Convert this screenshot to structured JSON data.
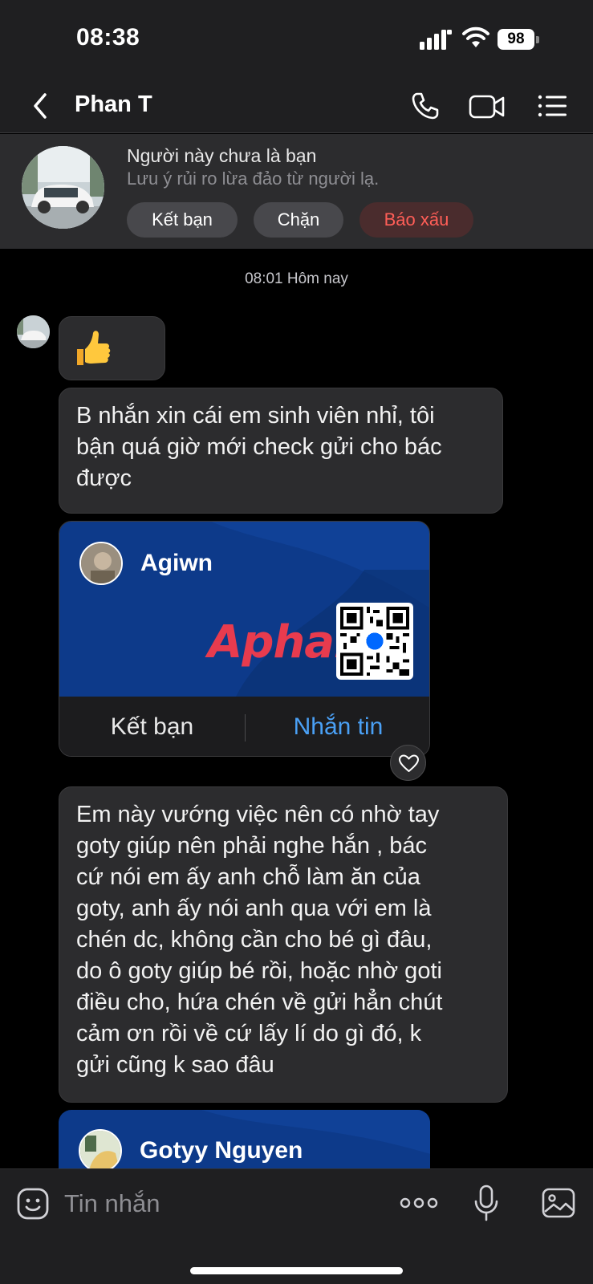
{
  "status_bar": {
    "time": "08:38",
    "battery": "98"
  },
  "header": {
    "title": "Phan T",
    "icons": [
      "back-icon",
      "phone-icon",
      "video-camera-icon",
      "list-menu-icon"
    ]
  },
  "stranger_notice": {
    "title": "Người này chưa là bạn",
    "subtitle": "Lưu ý rủi ro lừa đảo từ người lạ.",
    "add_friend_label": "Kết bạn",
    "block_label": "Chặn",
    "report_label": "Báo xấu",
    "report_color": "#ff5e57"
  },
  "chat": {
    "date_separator": "08:01 Hôm nay",
    "messages": [
      {
        "type": "sticker",
        "content": "👍"
      },
      {
        "type": "text",
        "content": "B nhắn xin cái em sinh viên nhỉ, tôi\nbận quá giờ mới check gửi cho bác\nđược"
      },
      {
        "type": "contact_card",
        "name": "Agiwn",
        "add_friend_label": "Kết bạn",
        "message_label": "Nhắn tin"
      },
      {
        "type": "text",
        "content": "Em này vướng việc nên có nhờ tay\ngoty  giúp nên phải nghe hắn , bác\ncứ nói em ấy anh chỗ làm ăn của\ngoty, anh ấy nói anh qua với em là\nchén dc, không cần cho bé gì đâu,\ndo ô goty giúp bé rồi, hoặc nhờ goti\nđiều cho, hứa chén về gửi hẳn chút\ncảm ơn rồi về cứ lấy lí do gì đó, k\ngửi cũng k sao đâu"
      },
      {
        "type": "contact_card",
        "name": "Gotyy Nguyen"
      }
    ],
    "card_watermark": "Aphang",
    "qr_badge": "Zalo"
  },
  "composer": {
    "placeholder": "Tin nhắn",
    "accent": "#4aa0f5"
  }
}
